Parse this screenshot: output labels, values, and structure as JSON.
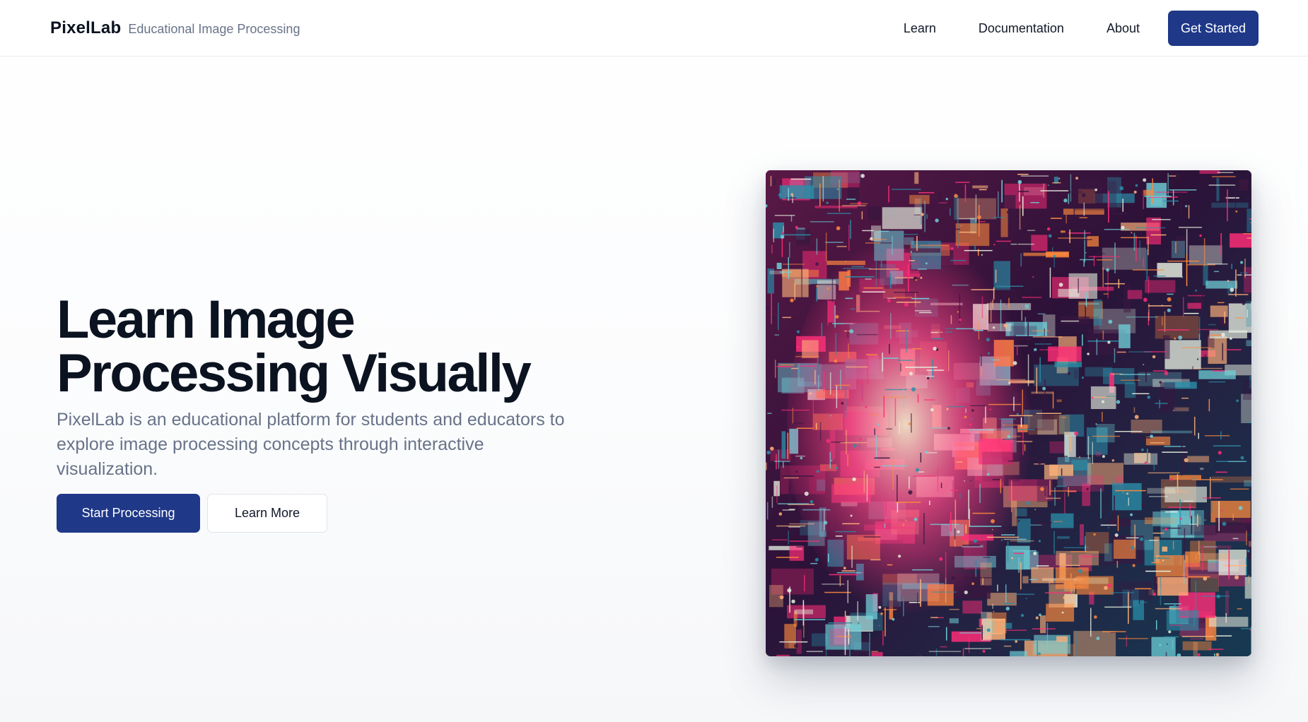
{
  "header": {
    "brand_name": "PixelLab",
    "brand_tagline": "Educational Image Processing",
    "nav": [
      "Learn",
      "Documentation",
      "About"
    ],
    "cta_label": "Get Started"
  },
  "hero": {
    "title": "Learn Image Processing Visually",
    "description": "PixelLab is an educational platform for students and educators to explore image processing concepts through interactive visualization.",
    "primary_label": "Start Processing",
    "secondary_label": "Learn More"
  },
  "colors": {
    "accent": "#1f3888",
    "text_dark": "#0b1220",
    "text_muted": "#687389",
    "art_palette": [
      "#ff2d78",
      "#2b8ea8",
      "#ffb37a",
      "#3a1740",
      "#e8f0e0",
      "#ff8a3d",
      "#6fd0d8"
    ]
  },
  "media": {
    "hero_image": "abstract digital portrait of a face made of circuit-board and pixel glitch patterns in pink, teal and orange"
  }
}
